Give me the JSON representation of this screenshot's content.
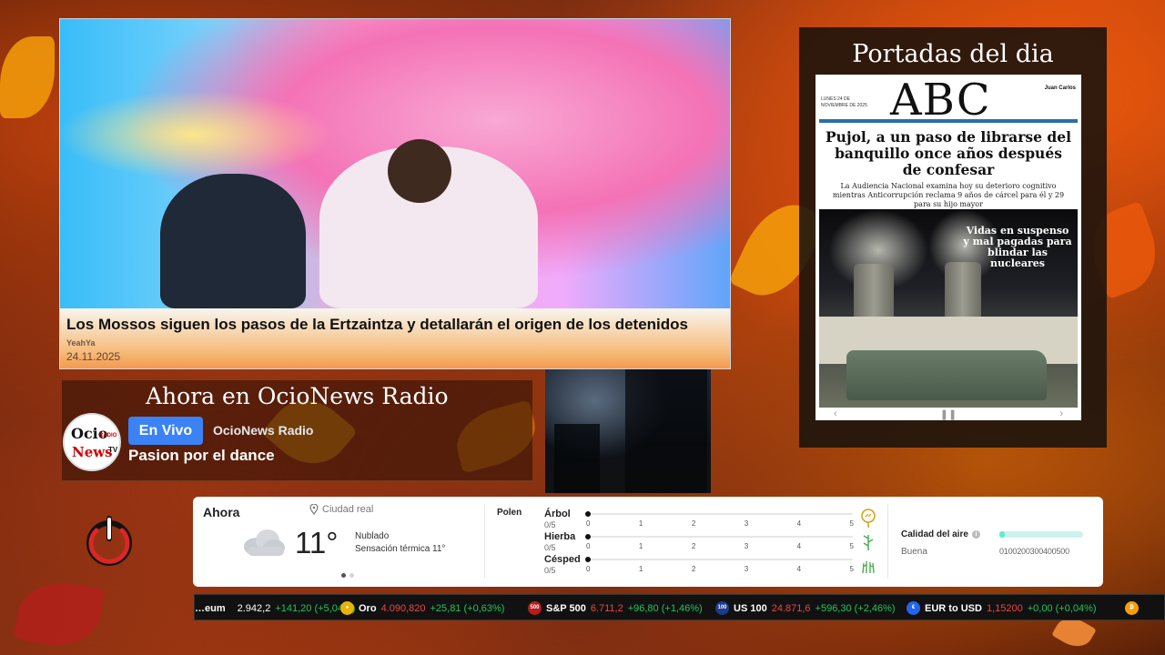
{
  "news": {
    "title": "Los Mossos siguen los pasos de la Ertzaintza y detallarán el origen de los detenidos",
    "source": "YeahYa",
    "date": "24.11.2025"
  },
  "portadas": {
    "title": "Portadas del dia",
    "cover": {
      "logo": "ABC",
      "date": "LUNES 24 DE NOVIEMBRE DE 2025",
      "right_text": "Juan Carlos",
      "headline": "Pujol, a un paso de librarse del banquillo once años después de confesar",
      "subheadline": "La Audiencia Nacional examina hoy su deterioro cognitivo mientras Anticorrupción reclama 9 años de cárcel para él y 29 para su hijo mayor",
      "photo_headline": "Vidas en suspenso y mal pagadas para blindar las nucleares"
    }
  },
  "radio": {
    "heading": "Ahora en OcioNews Radio",
    "logo_top": "Ocio",
    "logo_radio": "RADIO",
    "logo_bottom": "News",
    "logo_tv": "TV",
    "live_label": "En Vivo",
    "station": "OcioNews Radio",
    "show": "Pasion por el dance"
  },
  "weather": {
    "now_label": "Ahora",
    "location": "Ciudad real",
    "temperature": "11°",
    "condition": "Nublado",
    "feels_like": "Sensación térmica 11°",
    "icon": "cloud-icon",
    "polen_label": "Polen",
    "pollen": [
      {
        "name": "Árbol",
        "value": "0/5",
        "level": 0,
        "icon": "tree-pollen-icon"
      },
      {
        "name": "Hierba",
        "value": "0/5",
        "level": 0,
        "icon": "herb-pollen-icon"
      },
      {
        "name": "Césped",
        "value": "0/5",
        "level": 0,
        "icon": "grass-pollen-icon"
      }
    ],
    "scale_ticks": [
      "0",
      "1",
      "2",
      "3",
      "4",
      "5"
    ],
    "air_quality": {
      "title": "Calidad del aire",
      "level": "Buena",
      "scale": "0100200300400500",
      "value_fraction": 0.06
    }
  },
  "ticker": [
    {
      "name": "…eum",
      "price": "2.942,2",
      "price_color": "white",
      "change": "+141,20 (+5,04%)",
      "icon": ""
    },
    {
      "name": "Oro",
      "price": "4.090,820",
      "price_color": "red",
      "change": "+25,81 (+0,63%)",
      "icon": "gold-icon"
    },
    {
      "name": "S&P 500",
      "price": "6.711,2",
      "price_color": "red",
      "change": "+96,80 (+1,46%)",
      "icon": "sp500-icon",
      "icon_text": "500"
    },
    {
      "name": "US 100",
      "price": "24.871,6",
      "price_color": "red",
      "change": "+596,30 (+2,46%)",
      "icon": "us100-icon",
      "icon_text": "100"
    },
    {
      "name": "EUR to USD",
      "price": "1,15200",
      "price_color": "red",
      "change": "+0,00 (+0,04%)",
      "icon": "currency-icon"
    }
  ],
  "colors": {
    "accent_blue": "#3b82f6",
    "positive": "#22c55e",
    "negative": "#ef4444",
    "power_red": "#dc2626",
    "air_quality": "#5eead4"
  }
}
